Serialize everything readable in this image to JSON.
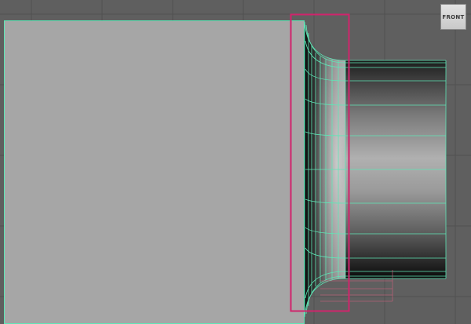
{
  "viewport": {
    "view_label": "FRONT",
    "colors": {
      "background": "#5f5f5f",
      "grid_line": "#505050",
      "plane_fill": "#a6a6a6",
      "wireframe": "#5fe6b6",
      "selection_box": "#d0246c",
      "hidden_edge": "#c8607a"
    }
  }
}
